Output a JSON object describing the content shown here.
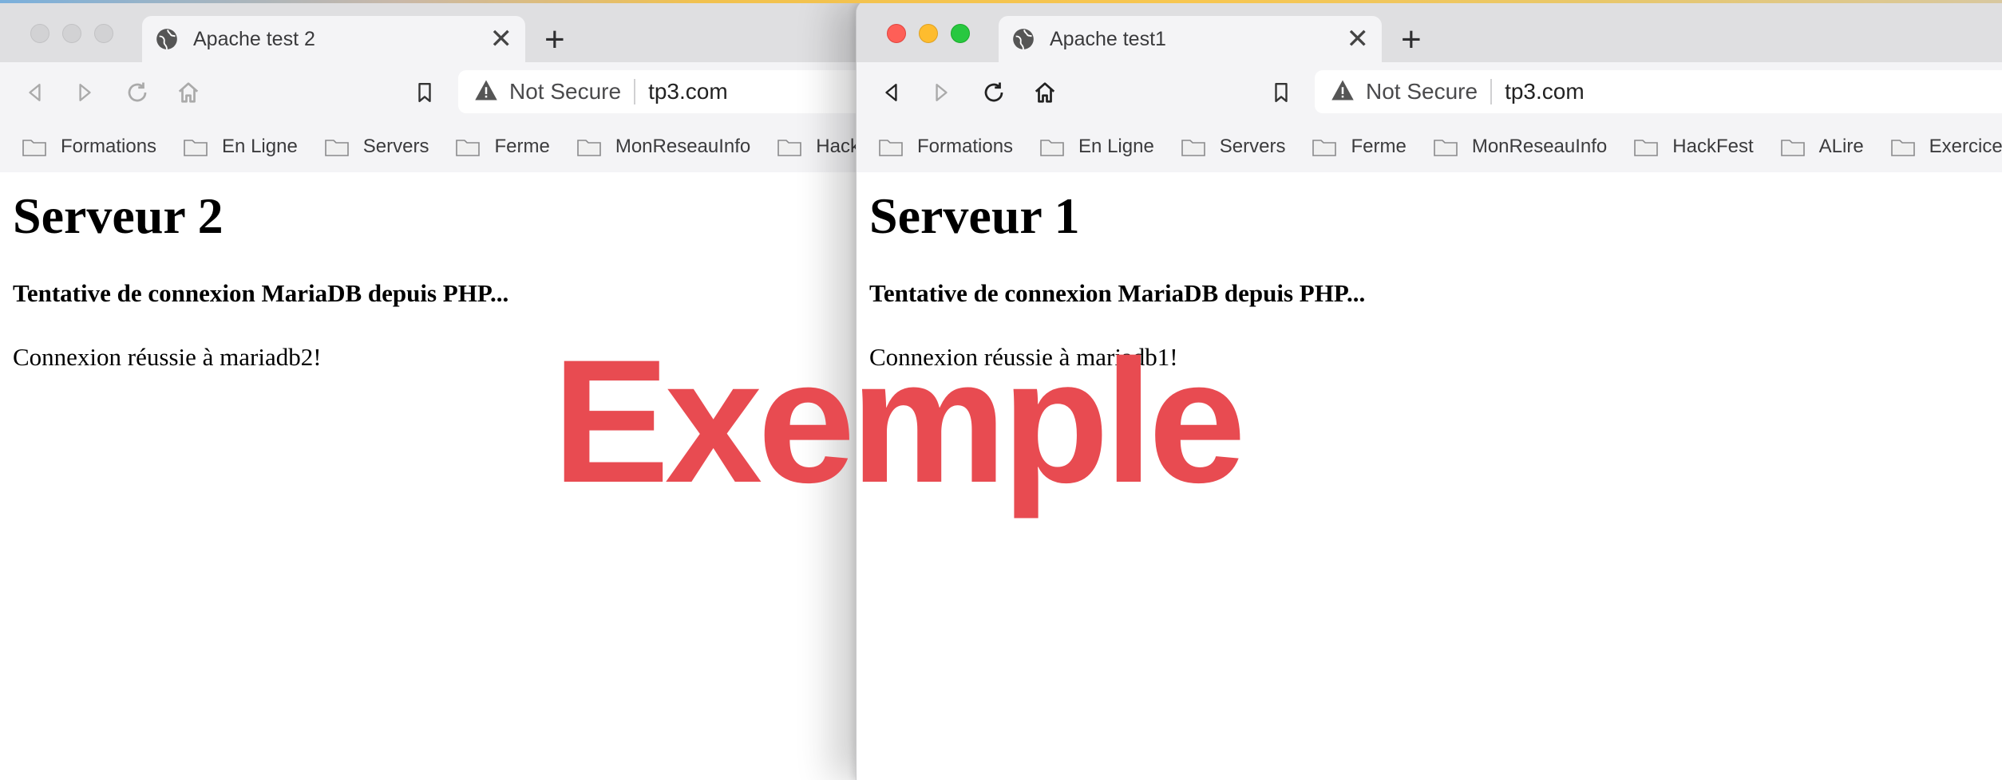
{
  "colors": {
    "watermark": "#e84b51",
    "tab_active": "#f4f4f6",
    "tabstrip": "#dfdfe1"
  },
  "icons": {
    "tab": "globe-icon",
    "back": "back-arrow-icon",
    "forward": "forward-arrow-icon",
    "reload": "reload-icon",
    "home": "home-icon",
    "bookmark": "bookmark-icon",
    "security": "warning-triangle-icon",
    "folder": "folder-icon"
  },
  "left_window": {
    "tab_title": "Apache test 2",
    "new_tab": "+",
    "tab_close": "✕",
    "not_secure": "Not Secure",
    "url": "tp3.com",
    "bookmarks": [
      "Formations",
      "En Ligne",
      "Servers",
      "Ferme",
      "MonReseauInfo",
      "HackFest"
    ],
    "page": {
      "heading": "Serveur 2",
      "subheading": "Tentative de connexion MariaDB depuis PHP...",
      "message": "Connexion réussie à mariadb2!"
    }
  },
  "right_window": {
    "tab_title": "Apache test1",
    "new_tab": "+",
    "tab_close": "✕",
    "not_secure": "Not Secure",
    "url": "tp3.com",
    "bookmarks": [
      "Formations",
      "En Ligne",
      "Servers",
      "Ferme",
      "MonReseauInfo",
      "HackFest",
      "ALire",
      "Exercices"
    ],
    "page": {
      "heading": "Serveur 1",
      "subheading": "Tentative de connexion MariaDB depuis PHP...",
      "message": "Connexion réussie à mariadb1!"
    }
  },
  "watermark_text": "Exemple"
}
